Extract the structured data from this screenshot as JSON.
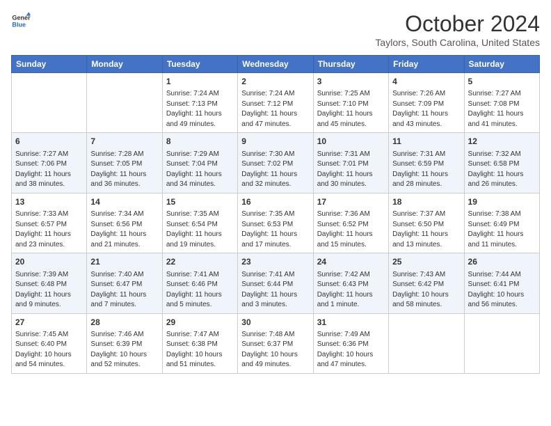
{
  "header": {
    "logo_line1": "General",
    "logo_line2": "Blue",
    "month": "October 2024",
    "location": "Taylors, South Carolina, United States"
  },
  "days_of_week": [
    "Sunday",
    "Monday",
    "Tuesday",
    "Wednesday",
    "Thursday",
    "Friday",
    "Saturday"
  ],
  "weeks": [
    [
      {
        "day": "",
        "info": ""
      },
      {
        "day": "",
        "info": ""
      },
      {
        "day": "1",
        "info": "Sunrise: 7:24 AM\nSunset: 7:13 PM\nDaylight: 11 hours and 49 minutes."
      },
      {
        "day": "2",
        "info": "Sunrise: 7:24 AM\nSunset: 7:12 PM\nDaylight: 11 hours and 47 minutes."
      },
      {
        "day": "3",
        "info": "Sunrise: 7:25 AM\nSunset: 7:10 PM\nDaylight: 11 hours and 45 minutes."
      },
      {
        "day": "4",
        "info": "Sunrise: 7:26 AM\nSunset: 7:09 PM\nDaylight: 11 hours and 43 minutes."
      },
      {
        "day": "5",
        "info": "Sunrise: 7:27 AM\nSunset: 7:08 PM\nDaylight: 11 hours and 41 minutes."
      }
    ],
    [
      {
        "day": "6",
        "info": "Sunrise: 7:27 AM\nSunset: 7:06 PM\nDaylight: 11 hours and 38 minutes."
      },
      {
        "day": "7",
        "info": "Sunrise: 7:28 AM\nSunset: 7:05 PM\nDaylight: 11 hours and 36 minutes."
      },
      {
        "day": "8",
        "info": "Sunrise: 7:29 AM\nSunset: 7:04 PM\nDaylight: 11 hours and 34 minutes."
      },
      {
        "day": "9",
        "info": "Sunrise: 7:30 AM\nSunset: 7:02 PM\nDaylight: 11 hours and 32 minutes."
      },
      {
        "day": "10",
        "info": "Sunrise: 7:31 AM\nSunset: 7:01 PM\nDaylight: 11 hours and 30 minutes."
      },
      {
        "day": "11",
        "info": "Sunrise: 7:31 AM\nSunset: 6:59 PM\nDaylight: 11 hours and 28 minutes."
      },
      {
        "day": "12",
        "info": "Sunrise: 7:32 AM\nSunset: 6:58 PM\nDaylight: 11 hours and 26 minutes."
      }
    ],
    [
      {
        "day": "13",
        "info": "Sunrise: 7:33 AM\nSunset: 6:57 PM\nDaylight: 11 hours and 23 minutes."
      },
      {
        "day": "14",
        "info": "Sunrise: 7:34 AM\nSunset: 6:56 PM\nDaylight: 11 hours and 21 minutes."
      },
      {
        "day": "15",
        "info": "Sunrise: 7:35 AM\nSunset: 6:54 PM\nDaylight: 11 hours and 19 minutes."
      },
      {
        "day": "16",
        "info": "Sunrise: 7:35 AM\nSunset: 6:53 PM\nDaylight: 11 hours and 17 minutes."
      },
      {
        "day": "17",
        "info": "Sunrise: 7:36 AM\nSunset: 6:52 PM\nDaylight: 11 hours and 15 minutes."
      },
      {
        "day": "18",
        "info": "Sunrise: 7:37 AM\nSunset: 6:50 PM\nDaylight: 11 hours and 13 minutes."
      },
      {
        "day": "19",
        "info": "Sunrise: 7:38 AM\nSunset: 6:49 PM\nDaylight: 11 hours and 11 minutes."
      }
    ],
    [
      {
        "day": "20",
        "info": "Sunrise: 7:39 AM\nSunset: 6:48 PM\nDaylight: 11 hours and 9 minutes."
      },
      {
        "day": "21",
        "info": "Sunrise: 7:40 AM\nSunset: 6:47 PM\nDaylight: 11 hours and 7 minutes."
      },
      {
        "day": "22",
        "info": "Sunrise: 7:41 AM\nSunset: 6:46 PM\nDaylight: 11 hours and 5 minutes."
      },
      {
        "day": "23",
        "info": "Sunrise: 7:41 AM\nSunset: 6:44 PM\nDaylight: 11 hours and 3 minutes."
      },
      {
        "day": "24",
        "info": "Sunrise: 7:42 AM\nSunset: 6:43 PM\nDaylight: 11 hours and 1 minute."
      },
      {
        "day": "25",
        "info": "Sunrise: 7:43 AM\nSunset: 6:42 PM\nDaylight: 10 hours and 58 minutes."
      },
      {
        "day": "26",
        "info": "Sunrise: 7:44 AM\nSunset: 6:41 PM\nDaylight: 10 hours and 56 minutes."
      }
    ],
    [
      {
        "day": "27",
        "info": "Sunrise: 7:45 AM\nSunset: 6:40 PM\nDaylight: 10 hours and 54 minutes."
      },
      {
        "day": "28",
        "info": "Sunrise: 7:46 AM\nSunset: 6:39 PM\nDaylight: 10 hours and 52 minutes."
      },
      {
        "day": "29",
        "info": "Sunrise: 7:47 AM\nSunset: 6:38 PM\nDaylight: 10 hours and 51 minutes."
      },
      {
        "day": "30",
        "info": "Sunrise: 7:48 AM\nSunset: 6:37 PM\nDaylight: 10 hours and 49 minutes."
      },
      {
        "day": "31",
        "info": "Sunrise: 7:49 AM\nSunset: 6:36 PM\nDaylight: 10 hours and 47 minutes."
      },
      {
        "day": "",
        "info": ""
      },
      {
        "day": "",
        "info": ""
      }
    ]
  ]
}
